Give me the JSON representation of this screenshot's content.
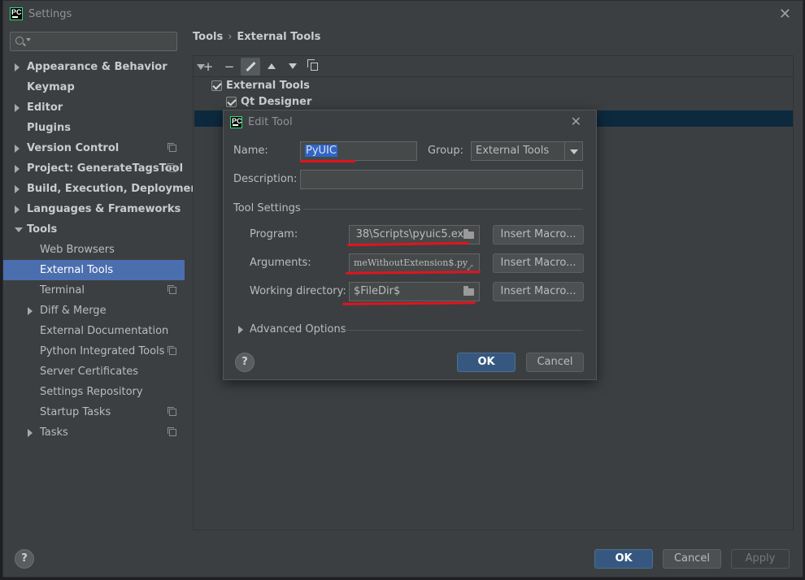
{
  "window": {
    "title": "Settings"
  },
  "search": {
    "placeholder": ""
  },
  "sidebar": {
    "items": [
      {
        "label": "Appearance & Behavior",
        "level": 0,
        "arrow": "right",
        "bold": true,
        "project": false
      },
      {
        "label": "Keymap",
        "level": 0,
        "arrow": "",
        "bold": true,
        "project": false
      },
      {
        "label": "Editor",
        "level": 0,
        "arrow": "right",
        "bold": true,
        "project": false
      },
      {
        "label": "Plugins",
        "level": 0,
        "arrow": "",
        "bold": true,
        "project": false
      },
      {
        "label": "Version Control",
        "level": 0,
        "arrow": "right",
        "bold": true,
        "project": true
      },
      {
        "label": "Project: GenerateTagsTool",
        "level": 0,
        "arrow": "right",
        "bold": true,
        "project": true
      },
      {
        "label": "Build, Execution, Deployment",
        "level": 0,
        "arrow": "right",
        "bold": true,
        "project": false
      },
      {
        "label": "Languages & Frameworks",
        "level": 0,
        "arrow": "right",
        "bold": true,
        "project": false
      },
      {
        "label": "Tools",
        "level": 0,
        "arrow": "down",
        "bold": true,
        "project": false
      },
      {
        "label": "Web Browsers",
        "level": 1,
        "arrow": "",
        "bold": false,
        "project": false
      },
      {
        "label": "External Tools",
        "level": 1,
        "arrow": "",
        "bold": false,
        "project": false,
        "selected": true
      },
      {
        "label": "Terminal",
        "level": 1,
        "arrow": "",
        "bold": false,
        "project": true
      },
      {
        "label": "Diff & Merge",
        "level": 1,
        "arrow": "right",
        "bold": false,
        "project": false
      },
      {
        "label": "External Documentation",
        "level": 1,
        "arrow": "",
        "bold": false,
        "project": false
      },
      {
        "label": "Python Integrated Tools",
        "level": 1,
        "arrow": "",
        "bold": false,
        "project": true
      },
      {
        "label": "Server Certificates",
        "level": 1,
        "arrow": "",
        "bold": false,
        "project": false
      },
      {
        "label": "Settings Repository",
        "level": 1,
        "arrow": "",
        "bold": false,
        "project": false
      },
      {
        "label": "Startup Tasks",
        "level": 1,
        "arrow": "",
        "bold": false,
        "project": true
      },
      {
        "label": "Tasks",
        "level": 1,
        "arrow": "right",
        "bold": false,
        "project": true
      }
    ]
  },
  "breadcrumb": {
    "parent": "Tools",
    "separator": "›",
    "current": "External Tools"
  },
  "toolbar": {
    "add": "+",
    "remove": "−"
  },
  "tools_tree": {
    "group_label": "External Tools",
    "tool_label": "Qt Designer"
  },
  "dialog": {
    "title": "Edit Tool",
    "name_label": "Name:",
    "name_value": "PyUIC",
    "group_label": "Group:",
    "group_value": "External Tools",
    "description_label": "Description:",
    "description_value": "",
    "tool_settings_label": "Tool Settings",
    "program_label": "Program:",
    "program_value": " 38\\Scripts\\pyuic5.exe",
    "arguments_label": "Arguments:",
    "arguments_value": "meWithoutExtension$.py",
    "workdir_label": "Working directory:",
    "workdir_value": "$FileDir$",
    "insert_macro": "Insert Macro...",
    "advanced_label": "Advanced Options",
    "help": "?",
    "ok": "OK",
    "cancel": "Cancel"
  },
  "footer": {
    "help": "?",
    "ok": "OK",
    "cancel": "Cancel",
    "apply": "Apply"
  },
  "colors": {
    "selection": "#4b6eaf",
    "primary_button": "#365880",
    "annotation_red": "#e0141e",
    "row_highlight": "#0d293e"
  }
}
